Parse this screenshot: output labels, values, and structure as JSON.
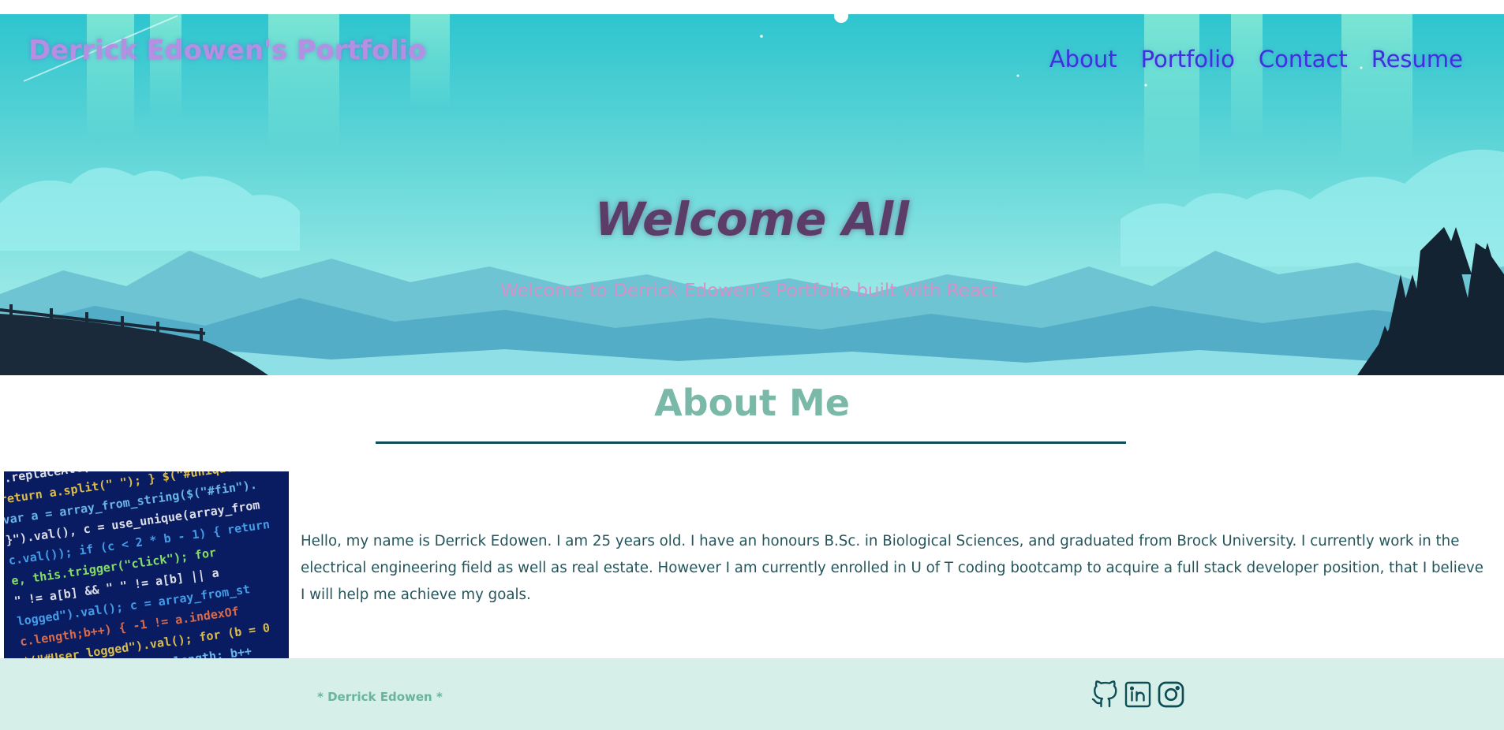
{
  "header": {
    "brand": "Derrick Edowen's Portfolio",
    "nav": [
      {
        "label": "About"
      },
      {
        "label": "Portfolio"
      },
      {
        "label": "Contact"
      },
      {
        "label": "Resume"
      }
    ]
  },
  "hero": {
    "title": "Welcome All",
    "subtitle": "Welcome to Derrick Edowen's Portfolio built with React."
  },
  "about": {
    "heading": "About Me",
    "text": "Hello, my name is Derrick Edowen. I am 25 years old. I have an honours B.Sc. in Biological Sciences, and graduated from Brock University. I currently work in the electrical engineering field as well as real estate. However I am currently enrolled in U of T coding bootcamp to acquire a full stack developer position, that I believe I will help me achieve my goals."
  },
  "footer": {
    "name": "* Derrick Edowen *",
    "social_icons": [
      "github-icon",
      "linkedin-icon",
      "instagram-icon"
    ]
  },
  "colors": {
    "brand": "#b58fe3",
    "nav": "#3f2fe0",
    "hero_title": "#5b3d68",
    "hero_subtitle": "#d590c8",
    "about_heading": "#7ab8a8",
    "divider": "#0f4d56",
    "body_text": "#25555a",
    "footer_bg": "#d6f0e9",
    "footer_name": "#6ab39d",
    "social_icon": "#0f4d56"
  }
}
